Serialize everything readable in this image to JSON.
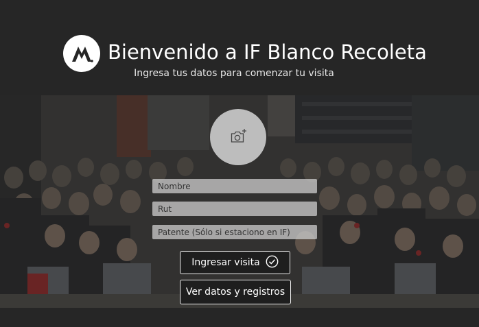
{
  "header": {
    "logo_icon": "brand-m-logo",
    "title": "Bienvenido a IF Blanco Recoleta",
    "subtitle": "Ingresa tus datos para comenzar tu visita"
  },
  "hero": {
    "background": "group-photo-crowd"
  },
  "form": {
    "photo_upload_icon": "camera-add-icon",
    "name_placeholder": "Nombre",
    "rut_placeholder": "Rut",
    "plate_placeholder": "Patente (Sólo si estaciono en IF)",
    "submit_label": "Ingresar visita",
    "submit_icon": "check-circle-icon",
    "records_label": "Ver datos y registros"
  },
  "colors": {
    "background": "#262626",
    "field_background": "#c8c8c8",
    "button_background": "#1e1e1e",
    "button_border": "#f2f2f2"
  }
}
